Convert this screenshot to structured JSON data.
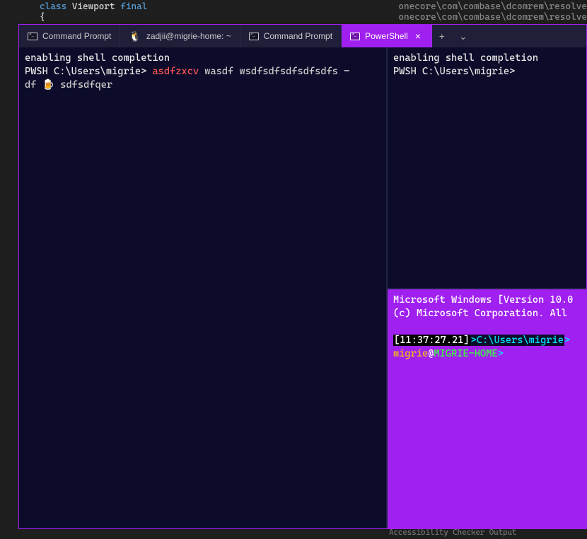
{
  "editor": {
    "code_line1_kw": "class",
    "code_line1_name": "Viewport",
    "code_line1_final": "final",
    "code_line2": "{",
    "right_line1": "onecore\\com\\combase\\dcomrem\\resolve",
    "right_line2": "onecore\\com\\combase\\dcomrem\\resolve",
    "status_text": "Accessibility Checker   Output"
  },
  "tabs": [
    {
      "label": "Command Prompt",
      "icon": "cmd"
    },
    {
      "label": "zadjii@migrie-home: ~",
      "icon": "tux"
    },
    {
      "label": "Command Prompt",
      "icon": "cmd"
    },
    {
      "label": "PowerShell",
      "icon": "cmd",
      "active": true
    }
  ],
  "tab_controls": {
    "close": "×",
    "new": "+",
    "dropdown": "⌄"
  },
  "pane_left": {
    "line1": "enabling shell completion",
    "prompt": "PWSH C:\\Users\\migrie>",
    "arg_red": "asdfzxcv",
    "arg_gray": "wasdf wsdfsdfsdfsdfsdfs",
    "dash": "-",
    "cont": "df",
    "emoji": "🍺",
    "rest": "sdfsdfqer"
  },
  "pane_right_top": {
    "line1": "enabling shell completion",
    "prompt": "PWSH C:\\Users\\migrie>"
  },
  "pane_right_bottom": {
    "line1": "Microsoft Windows [Version 10.0",
    "line2": "(c) Microsoft Corporation. All",
    "time": "[11:37:27.21]",
    "path_arrow": ">",
    "path": "C:\\Users\\migrie",
    "path_end": ">",
    "user": "migrie",
    "at": "@",
    "host": "MIGRIE-HOME",
    "end_gt": ">"
  }
}
